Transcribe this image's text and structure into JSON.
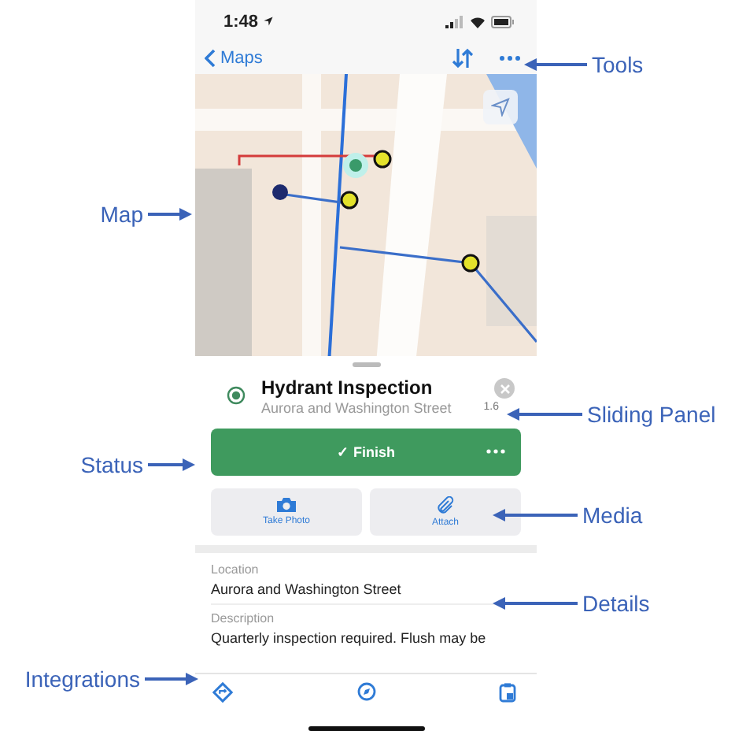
{
  "status_bar": {
    "time": "1:48"
  },
  "nav": {
    "back": "Maps"
  },
  "panel": {
    "title": "Hydrant Inspection",
    "subtitle": "Aurora and Washington Street",
    "distance": "1.6"
  },
  "finish": {
    "label": "✓ Finish"
  },
  "media": [
    {
      "kind": "camera",
      "label": "Take Photo"
    },
    {
      "kind": "paperclip",
      "label": "Attach"
    }
  ],
  "details": [
    {
      "label": "Location",
      "value": "Aurora and Washington Street"
    },
    {
      "label": "Description",
      "value": "Quarterly inspection required. Flush may be"
    }
  ],
  "callouts": [
    {
      "label": "Tools"
    },
    {
      "label": "Map"
    },
    {
      "label": "Sliding Panel"
    },
    {
      "label": "Status"
    },
    {
      "label": "Media"
    },
    {
      "label": "Details"
    },
    {
      "label": "Integrations"
    }
  ]
}
